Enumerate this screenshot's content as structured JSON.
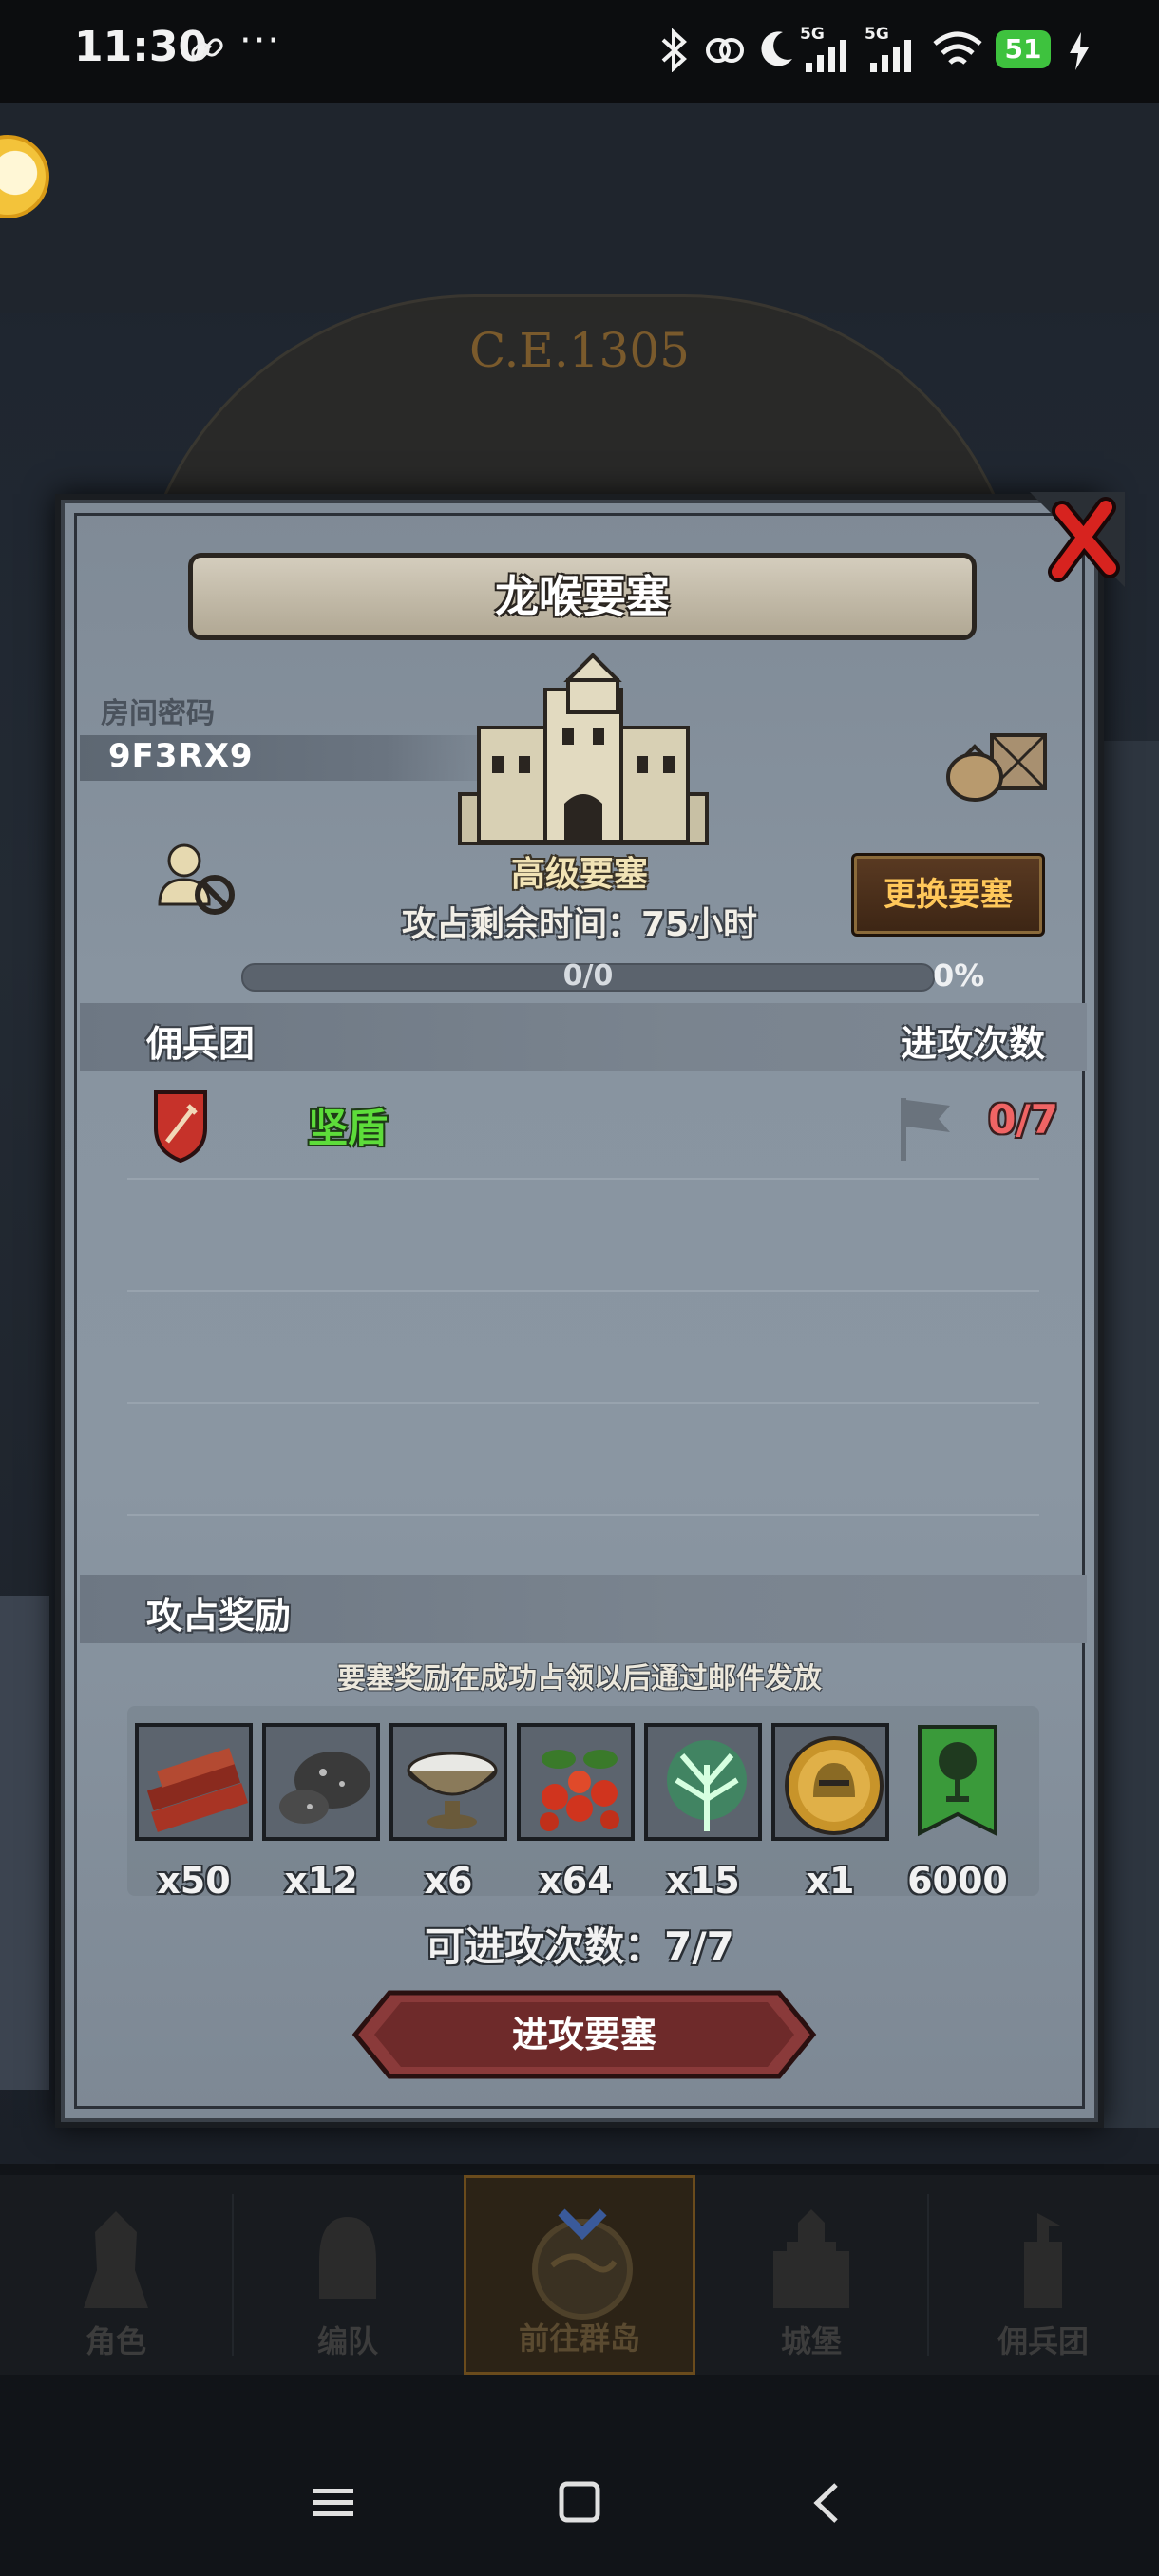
{
  "status_bar": {
    "time": "11:30",
    "dots": "···",
    "battery": "51",
    "net1": "5G",
    "net2": "5G"
  },
  "background": {
    "era": "C.E.1305"
  },
  "modal": {
    "title": "龙喉要塞",
    "room_label": "房间密码",
    "room_code": "9F3RX9",
    "fortress_level": "高级要塞",
    "change_button": "更换要塞",
    "remaining_time": "攻占剩余时间：75小时",
    "progress_text": "0/0",
    "progress_percent": "0%",
    "progress_value": 0,
    "mercenary_header": "佣兵团",
    "attack_count_header": "进攻次数",
    "mercenaries": [
      {
        "name": "坚盾",
        "count": "0/7"
      }
    ],
    "reward_header": "攻占奖励",
    "reward_note": "要塞奖励在成功占领以后通过邮件发放",
    "rewards": [
      {
        "icon": "wood-icon",
        "qty": "x50"
      },
      {
        "icon": "ore-icon",
        "qty": "x12"
      },
      {
        "icon": "silver-bowl-icon",
        "qty": "x6"
      },
      {
        "icon": "berries-icon",
        "qty": "x64"
      },
      {
        "icon": "green-tree-icon",
        "qty": "x15"
      },
      {
        "icon": "gold-helmet-medal-icon",
        "qty": "x1"
      },
      {
        "icon": "tree-banner-icon",
        "qty": "6000"
      }
    ],
    "attack_remaining": "可进攻次数：7/7",
    "attack_button": "进攻要塞"
  },
  "bottom_nav": {
    "items": [
      {
        "label": "角色"
      },
      {
        "label": "编队"
      },
      {
        "label": "前往群岛"
      },
      {
        "label": "城堡"
      },
      {
        "label": "佣兵团"
      }
    ]
  },
  "colors": {
    "modal_bg": "#8894a0",
    "change_button_text": "#ffc85a",
    "mercenary_name": "#5ddc3a",
    "attack_count": "#f06464",
    "attack_button": "#8a3a3a"
  }
}
